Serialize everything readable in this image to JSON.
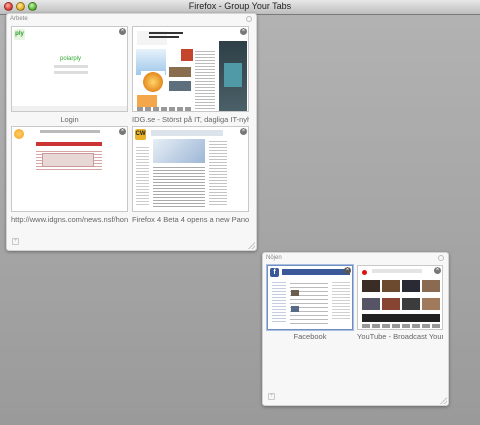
{
  "window": {
    "title": "Firefox - Group Your Tabs"
  },
  "groups": [
    {
      "name": "Arbete",
      "tabs": [
        {
          "label": "Login",
          "favicon": "ply-logo-icon",
          "favicon_text": "ply",
          "page_text": "polarply"
        },
        {
          "label": "IDG.se - Störst på IT, dagliga IT-nyh",
          "favicon": "none"
        },
        {
          "label": "http://www.idgns.com/news.nsf/hon",
          "favicon": "orange-circle-icon"
        },
        {
          "label": "Firefox 4 Beta 4 opens a new Panora",
          "favicon": "cw-logo-icon",
          "favicon_text": "CW"
        }
      ]
    },
    {
      "name": "Nöjen",
      "tabs": [
        {
          "label": "Facebook",
          "favicon": "facebook-icon",
          "favicon_text": "f"
        },
        {
          "label": "YouTube - Broadcast Yours",
          "favicon": "youtube-icon"
        }
      ]
    }
  ],
  "colors": {
    "background": "#a8a8a8",
    "group_bg": "#f7f7f7",
    "active_border": "#6d8fc2",
    "facebook_blue": "#3b5998"
  }
}
